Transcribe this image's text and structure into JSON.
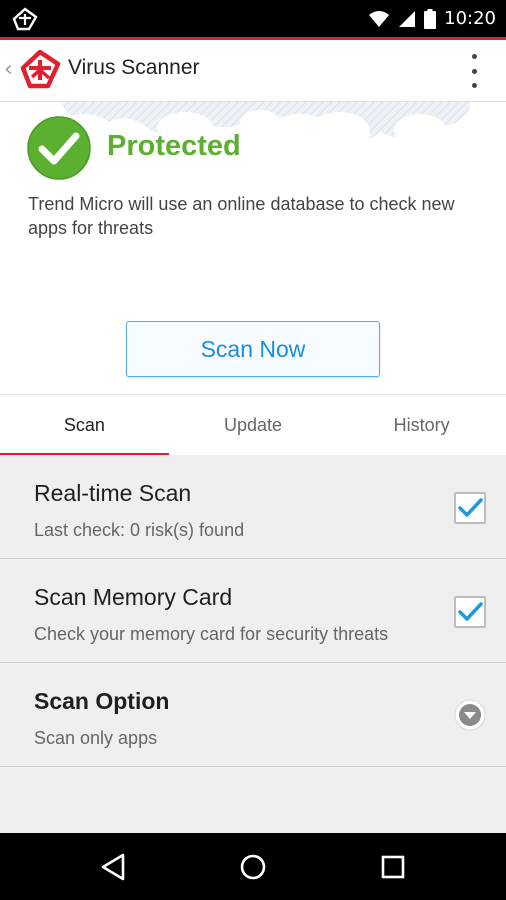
{
  "status_bar": {
    "time": "10:20",
    "icons": [
      "trend-micro-logo-icon",
      "wifi-icon",
      "signal-icon",
      "battery-icon"
    ]
  },
  "app_bar": {
    "title": "Virus Scanner",
    "back_icon": "chevron-left-icon",
    "menu_icon": "overflow-menu-icon"
  },
  "hero": {
    "status": "Protected",
    "description": "Trend Micro will use an online database to check new apps for threats",
    "scan_button": "Scan Now"
  },
  "tabs": [
    {
      "label": "Scan",
      "active": true
    },
    {
      "label": "Update",
      "active": false
    },
    {
      "label": "History",
      "active": false
    }
  ],
  "settings": [
    {
      "title": "Real-time Scan",
      "subtitle": "Last check: 0 risk(s) found",
      "control": "checkbox",
      "checked": true
    },
    {
      "title": "Scan Memory Card",
      "subtitle": "Check your memory card for security threats",
      "control": "checkbox",
      "checked": true
    },
    {
      "title": "Scan Option",
      "subtitle": "Scan only apps",
      "control": "dropdown"
    }
  ],
  "colors": {
    "accent_red": "#e0202f",
    "protected_green": "#5cb030",
    "link_blue": "#1a8de0",
    "check_blue": "#1e9ad6"
  }
}
